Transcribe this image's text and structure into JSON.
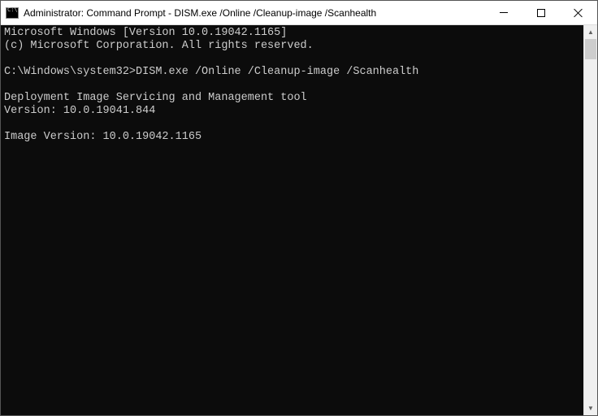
{
  "window": {
    "title": "Administrator: Command Prompt - DISM.exe  /Online /Cleanup-image /Scanhealth"
  },
  "terminal": {
    "line1": "Microsoft Windows [Version 10.0.19042.1165]",
    "line2": "(c) Microsoft Corporation. All rights reserved.",
    "blank1": "",
    "prompt_path": "C:\\Windows\\system32>",
    "command": "DISM.exe /Online /Cleanup-image /Scanhealth",
    "blank2": "",
    "dism_title": "Deployment Image Servicing and Management tool",
    "dism_version": "Version: 10.0.19041.844",
    "blank3": "",
    "image_version": "Image Version: 10.0.19042.1165"
  }
}
